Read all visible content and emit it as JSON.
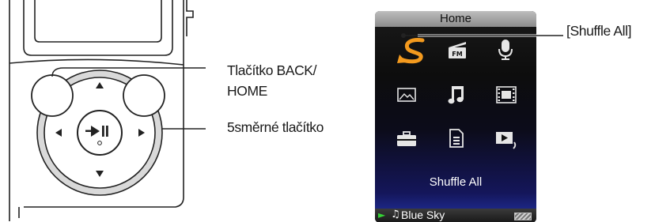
{
  "callouts": {
    "back_home": "Tlačítko BACK/ HOME",
    "five_way": "5směrné tlačítko",
    "shuffle_all": "[Shuffle All]"
  },
  "screen": {
    "title": "Home",
    "selected_item_label": "Shuffle All",
    "status": {
      "song": "Blue Sky"
    },
    "icons": [
      "shuffle-icon",
      "fm-radio-icon",
      "microphone-icon",
      "photo-icon",
      "music-icon",
      "video-icon",
      "settings-icon",
      "playlist-icon",
      "now-playing-icon"
    ]
  },
  "device": {
    "buttons": [
      "back-home-button",
      "option-button",
      "up-button",
      "down-button",
      "left-button",
      "right-button",
      "play-pause-button"
    ]
  },
  "colors": {
    "selected_icon": "#f39a1e",
    "play_indicator": "#35d235"
  }
}
